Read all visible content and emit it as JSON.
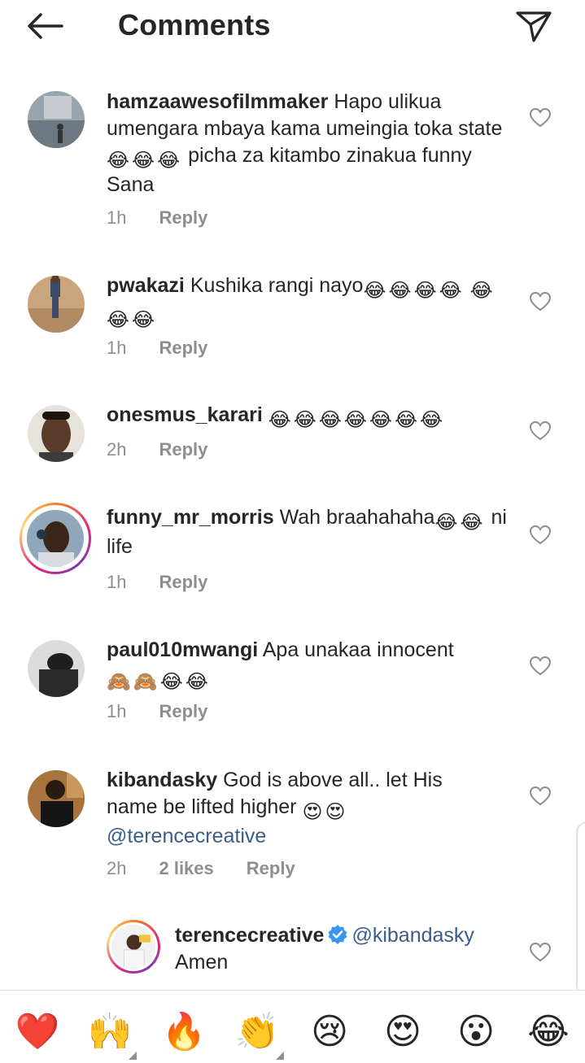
{
  "header": {
    "title": "Comments",
    "back_icon": "arrow-left-icon",
    "send_icon": "paper-plane-icon"
  },
  "comments": [
    {
      "user": "hamzaawesofilmmaker",
      "text_before": "Hapo ulikua umengara mbaya kama umeingia toka state ",
      "emoji_mid": [
        "😂",
        "😂",
        "😂"
      ],
      "text_after": " picha za kitambo zinakua funny Sana",
      "time": "1h",
      "reply": "Reply"
    },
    {
      "user": "pwakazi",
      "text_before": "Kushika rangi nayo",
      "emoji_mid": [
        "😂",
        "😂",
        "😂",
        "😂",
        "😂",
        "😂",
        "😂"
      ],
      "time": "1h",
      "reply": "Reply"
    },
    {
      "user": "onesmus_karari",
      "emoji_mid": [
        "😂",
        "😂",
        "😂",
        "😂",
        "😂",
        "😂",
        "😂"
      ],
      "time": "2h",
      "reply": "Reply"
    },
    {
      "user": "funny_mr_morris",
      "text_before": "Wah braahahaha",
      "emoji_mid": [
        "😂",
        "😂"
      ],
      "text_after": "ni life",
      "time": "1h",
      "reply": "Reply"
    },
    {
      "user": "paul010mwangi",
      "text_before": "Apa unakaa innocent ",
      "emoji_mid": [
        "🙈",
        "🙈",
        "😂",
        "😂"
      ],
      "time": "1h",
      "reply": "Reply"
    },
    {
      "user": "kibandasky",
      "text_before": "God is above all.. let His name be lifted higher ",
      "emoji_mid": [
        "😍",
        "😍"
      ],
      "mention": "@terencecreative",
      "time": "2h",
      "likes": "2 likes",
      "reply": "Reply"
    },
    {
      "user": "terencecreative",
      "verified": true,
      "mention": "@kibandasky",
      "text_after": "Amen"
    }
  ],
  "quick_reactions": [
    "❤️",
    "🙌",
    "🔥",
    "👏",
    "😢",
    "😍",
    "😮",
    "😂"
  ],
  "colors": {
    "mention": "#3a5d8a",
    "meta": "#8e8e8e",
    "text": "#262626",
    "verified": "#3897f0",
    "heart_react": "#ed1b24"
  }
}
